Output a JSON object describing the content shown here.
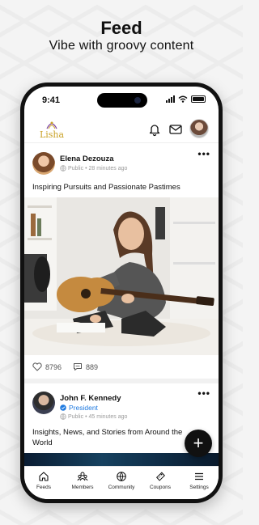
{
  "promo": {
    "title": "Feed",
    "subtitle": "Vibe with groovy content"
  },
  "status_bar": {
    "time": "9:41"
  },
  "app_header": {
    "logo_text": "Lisha",
    "icons": [
      "bell-icon",
      "mail-icon",
      "avatar"
    ]
  },
  "posts": [
    {
      "author": "Elena Dezouza",
      "visibility": "Public",
      "time": "28 minutes ago",
      "text": "Inspiring Pursuits and Passionate Pastimes",
      "likes": "8796",
      "comments": "889"
    },
    {
      "author": "John F. Kennedy",
      "badge": "President",
      "visibility": "Public",
      "time": "45 minutes ago",
      "text": "Insights, News, and Stories from Around the World"
    }
  ],
  "fab": {
    "label": "+"
  },
  "tabs": [
    {
      "label": "Feeds",
      "icon": "home-icon"
    },
    {
      "label": "Members",
      "icon": "members-icon"
    },
    {
      "label": "Community",
      "icon": "globe-icon"
    },
    {
      "label": "Coupons",
      "icon": "coupon-icon"
    },
    {
      "label": "Settings",
      "icon": "menu-icon"
    }
  ],
  "colors": {
    "accent": "#1f7ae0",
    "dark": "#111111",
    "logo": "#c9a227"
  }
}
